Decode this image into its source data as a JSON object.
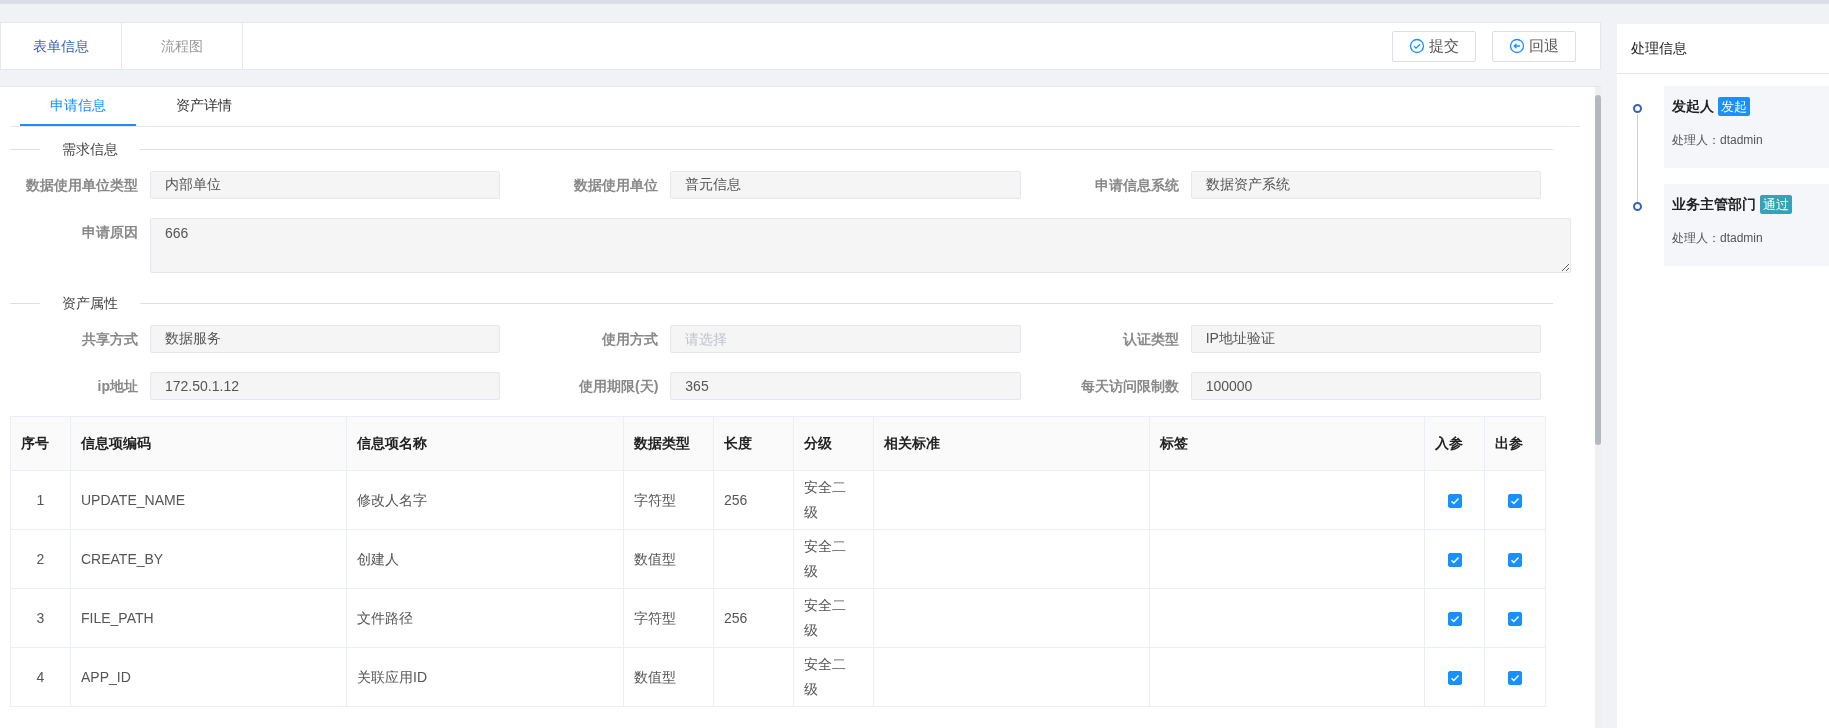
{
  "top_tabs": [
    {
      "label": "表单信息",
      "selected": true
    },
    {
      "label": "流程图",
      "selected": false
    }
  ],
  "actions": [
    {
      "kind": "submit",
      "label": "提交"
    },
    {
      "kind": "back",
      "label": "回退"
    }
  ],
  "inner_tabs": [
    {
      "label": "申请信息",
      "selected": true
    },
    {
      "label": "资产详情",
      "selected": false
    }
  ],
  "sections": [
    {
      "title": "需求信息",
      "fields": [
        {
          "kind": "input",
          "label": "数据使用单位类型",
          "value": "内部单位"
        },
        {
          "kind": "input",
          "label": "数据使用单位",
          "value": "普元信息"
        },
        {
          "kind": "input",
          "label": "申请信息系统",
          "value": "数据资产系统"
        },
        {
          "kind": "textarea",
          "label": "申请原因",
          "value": "666"
        }
      ]
    },
    {
      "title": "资产属性",
      "fields": [
        {
          "kind": "input",
          "label": "共享方式",
          "value": "数据服务"
        },
        {
          "kind": "input",
          "label": "使用方式",
          "placeholder": "请选择"
        },
        {
          "kind": "input",
          "label": "认证类型",
          "value": "IP地址验证"
        },
        {
          "kind": "input",
          "label": "ip地址",
          "value": "172.50.1.12"
        },
        {
          "kind": "input",
          "label": "使用期限(天)",
          "value": "365"
        },
        {
          "kind": "input",
          "label": "每天访问限制数",
          "value": "100000"
        }
      ]
    }
  ],
  "table": {
    "columns": [
      "序号",
      "信息项编码",
      "信息项名称",
      "数据类型",
      "长度",
      "分级",
      "相关标准",
      "标签",
      "入参",
      "出参"
    ],
    "rows": [
      {
        "index": "1",
        "code": "UPDATE_NAME",
        "name": "修改人名字",
        "type": "字符型",
        "length": "256",
        "grade": "安全二级",
        "in_param": true,
        "out_param": true
      },
      {
        "index": "2",
        "code": "CREATE_BY",
        "name": "创建人",
        "type": "数值型",
        "grade": "安全二级",
        "in_param": true,
        "out_param": true
      },
      {
        "index": "3",
        "code": "FILE_PATH",
        "name": "文件路径",
        "type": "字符型",
        "length": "256",
        "grade": "安全二级",
        "in_param": true,
        "out_param": true
      },
      {
        "index": "4",
        "code": "APP_ID",
        "name": "关联应用ID",
        "type": "数值型",
        "grade": "安全二级",
        "in_param": true,
        "out_param": true
      }
    ]
  },
  "process_panel": {
    "title": "处理信息",
    "steps": [
      {
        "title": "发起人",
        "tag": "发起",
        "color": "#1890ff",
        "handler": "处理人：dtadmin"
      },
      {
        "title": "业务主管部门",
        "tag": "通过",
        "color": "#36a3b5",
        "handler": "处理人：dtadmin"
      }
    ]
  }
}
